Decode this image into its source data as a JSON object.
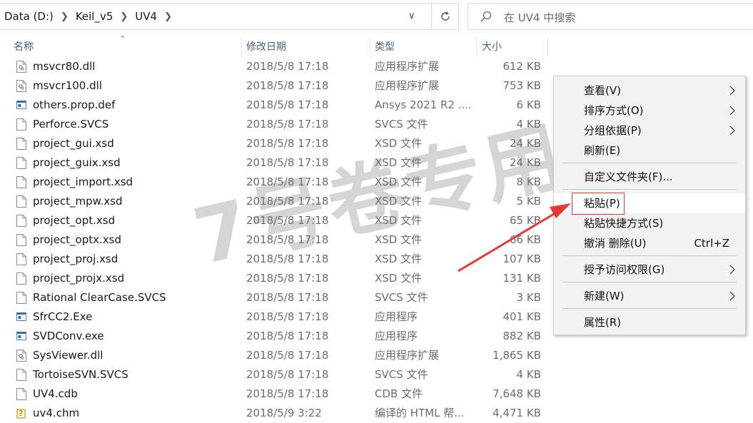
{
  "address": {
    "crumbs": [
      "Data (D:)",
      "Keil_v5",
      "UV4"
    ]
  },
  "search": {
    "placeholder": "在 UV4 中搜索"
  },
  "columns": {
    "name": "名称",
    "date": "修改日期",
    "type": "类型",
    "size": "大小"
  },
  "files": [
    {
      "name": "msvcr80.dll",
      "date": "2018/5/8 17:18",
      "type": "应用程序扩展",
      "size": "612 KB",
      "icon": "dll-file-icon"
    },
    {
      "name": "msvcr100.dll",
      "date": "2018/5/8 17:18",
      "type": "应用程序扩展",
      "size": "753 KB",
      "icon": "dll-file-icon"
    },
    {
      "name": "others.prop.def",
      "date": "2018/5/8 17:18",
      "type": "Ansys 2021 R2 ....",
      "size": "6 KB",
      "icon": "app-file-icon"
    },
    {
      "name": "Perforce.SVCS",
      "date": "2018/5/8 17:18",
      "type": "SVCS 文件",
      "size": "4 KB",
      "icon": "blank-file-icon"
    },
    {
      "name": "project_gui.xsd",
      "date": "2018/5/8 17:18",
      "type": "XSD 文件",
      "size": "24 KB",
      "icon": "blank-file-icon"
    },
    {
      "name": "project_guix.xsd",
      "date": "2018/5/8 17:18",
      "type": "XSD 文件",
      "size": "24 KB",
      "icon": "blank-file-icon"
    },
    {
      "name": "project_import.xsd",
      "date": "2018/5/8 17:18",
      "type": "XSD 文件",
      "size": "8 KB",
      "icon": "blank-file-icon"
    },
    {
      "name": "project_mpw.xsd",
      "date": "2018/5/8 17:18",
      "type": "XSD 文件",
      "size": "5 KB",
      "icon": "blank-file-icon"
    },
    {
      "name": "project_opt.xsd",
      "date": "2018/5/8 17:18",
      "type": "XSD 文件",
      "size": "65 KB",
      "icon": "blank-file-icon"
    },
    {
      "name": "project_optx.xsd",
      "date": "2018/5/8 17:18",
      "type": "XSD 文件",
      "size": "66 KB",
      "icon": "blank-file-icon"
    },
    {
      "name": "project_proj.xsd",
      "date": "2018/5/8 17:18",
      "type": "XSD 文件",
      "size": "107 KB",
      "icon": "blank-file-icon"
    },
    {
      "name": "project_projx.xsd",
      "date": "2018/5/8 17:18",
      "type": "XSD 文件",
      "size": "131 KB",
      "icon": "blank-file-icon"
    },
    {
      "name": "Rational ClearCase.SVCS",
      "date": "2018/5/8 17:18",
      "type": "SVCS 文件",
      "size": "3 KB",
      "icon": "blank-file-icon"
    },
    {
      "name": "SfrCC2.Exe",
      "date": "2018/5/8 17:18",
      "type": "应用程序",
      "size": "401 KB",
      "icon": "app-file-icon"
    },
    {
      "name": "SVDConv.exe",
      "date": "2018/5/8 17:18",
      "type": "应用程序",
      "size": "882 KB",
      "icon": "app-file-icon"
    },
    {
      "name": "SysViewer.dll",
      "date": "2018/5/8 17:18",
      "type": "应用程序扩展",
      "size": "1,865 KB",
      "icon": "dll-file-icon"
    },
    {
      "name": "TortoiseSVN.SVCS",
      "date": "2018/5/8 17:18",
      "type": "SVCS 文件",
      "size": "4 KB",
      "icon": "blank-file-icon"
    },
    {
      "name": "UV4.cdb",
      "date": "2018/5/8 17:18",
      "type": "CDB 文件",
      "size": "7,648 KB",
      "icon": "blank-file-icon"
    },
    {
      "name": "uv4.chm",
      "date": "2018/5/9 3:22",
      "type": "编译的 HTML 帮...",
      "size": "4,471 KB",
      "icon": "help-file-icon"
    }
  ],
  "watermark": "7号卷专用",
  "menu": {
    "view": "查看(V)",
    "sort": "排序方式(O)",
    "group": "分组依据(P)",
    "refresh": "刷新(E)",
    "customize": "自定义文件夹(F)...",
    "paste": "粘贴(P)",
    "paste_shortcut": "粘贴快捷方式(S)",
    "undo": "撤消 删除(U)",
    "undo_shortcut": "Ctrl+Z",
    "grant": "授予访问权限(G)",
    "new": "新建(W)",
    "properties": "属性(R)"
  },
  "colors": {
    "highlight_box": "#e53935",
    "arrow": "#e53935",
    "header_text": "#4c607a"
  }
}
